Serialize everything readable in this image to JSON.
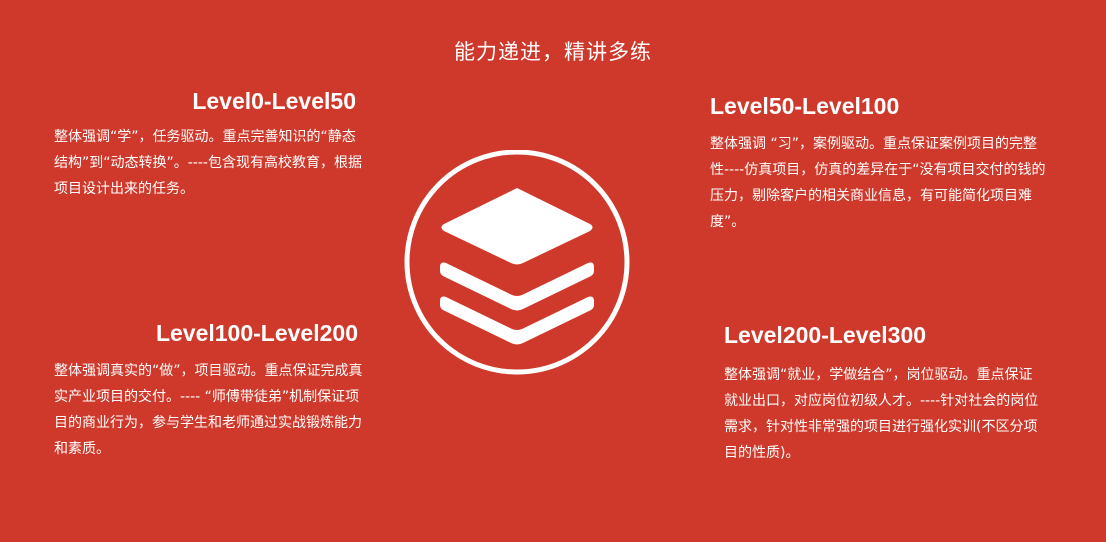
{
  "title": "能力递进，精讲多练",
  "blocks": [
    {
      "heading": "Level0-Level50",
      "text": "整体强调“学”，任务驱动。重点完善知识的“静态结构”到“动态转换”。----包含现有高校教育，根据项目设计出来的任务。"
    },
    {
      "heading": "Level50-Level100",
      "text": "整体强调 “习”，案例驱动。重点保证案例项目的完整性----仿真项目，仿真的差异在于“没有项目交付的钱的压力，剔除客户的相关商业信息，有可能简化项目难度”。"
    },
    {
      "heading": "Level100-Level200",
      "text": "整体强调真实的“做”，项目驱动。重点保证完成真实产业项目的交付。---- “师傅带徒弟”机制保证项目的商业行为，参与学生和老师通过实战锻炼能力和素质。"
    },
    {
      "heading": "Level200-Level300",
      "text": "整体强调“就业，学做结合”，岗位驱动。重点保证就业出口，对应岗位初级人才。----针对社会的岗位需求，针对性非常强的项目进行强化实训(不区分项目的性质)。"
    }
  ],
  "icons": {
    "center": "layers-icon"
  },
  "colors": {
    "background": "#cf392b",
    "foreground": "#ffffff"
  }
}
